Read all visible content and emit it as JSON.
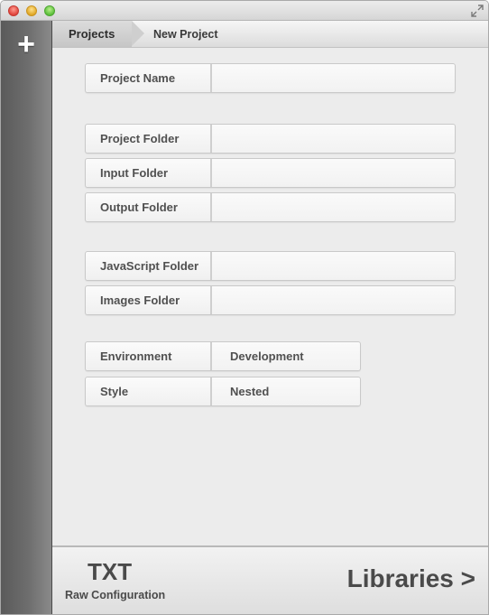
{
  "window": {
    "controls": {
      "close": "close-button",
      "minimize": "minimize-button",
      "zoom": "zoom-button"
    }
  },
  "sidebar": {
    "add_label": "+"
  },
  "breadcrumb": {
    "root": "Projects",
    "current": "New Project"
  },
  "form": {
    "project_name": {
      "label": "Project Name",
      "value": ""
    },
    "project_folder": {
      "label": "Project Folder",
      "value": ""
    },
    "input_folder": {
      "label": "Input Folder",
      "value": ""
    },
    "output_folder": {
      "label": "Output Folder",
      "value": ""
    },
    "javascript_folder": {
      "label": "JavaScript Folder",
      "value": ""
    },
    "images_folder": {
      "label": "Images Folder",
      "value": ""
    },
    "environment": {
      "label": "Environment",
      "value": "Development"
    },
    "style": {
      "label": "Style",
      "value": "Nested"
    }
  },
  "footer": {
    "txt_label": "TXT",
    "txt_sublabel": "Raw Configuration",
    "libraries_label": "Libraries >"
  }
}
